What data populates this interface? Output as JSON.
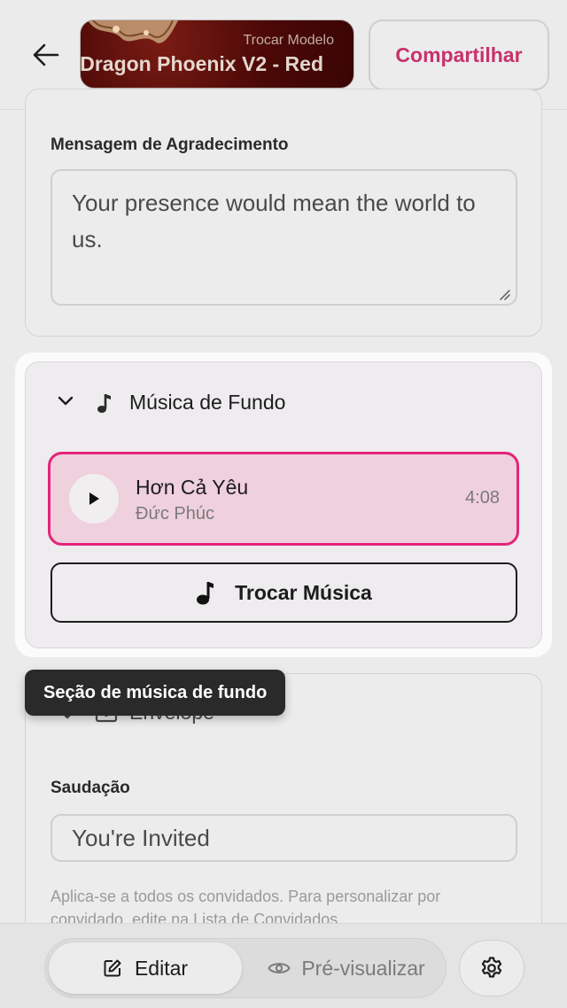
{
  "header": {
    "template_swap_label": "Trocar Modelo",
    "template_name": "Dragon Phoenix V2 - Red",
    "share_label": "Compartilhar"
  },
  "thanks_section": {
    "label": "Mensagem de Agradecimento",
    "value": "Your presence would mean the world to us."
  },
  "music_section": {
    "title": "Música de Fundo",
    "track": {
      "title": "Hơn Cả Yêu",
      "artist": "Đức Phúc",
      "duration": "4:08"
    },
    "swap_button_label": "Trocar Música"
  },
  "tooltip": {
    "text": "Seção de música de fundo"
  },
  "envelope_section": {
    "title": "Envelope",
    "greeting_label": "Saudação",
    "greeting_value": "You're Invited",
    "helper_text": "Aplica-se a todos os convidados. Para personalizar por convidado, edite na Lista de Convidados."
  },
  "bottom_bar": {
    "edit_label": "Editar",
    "preview_label": "Pré-visualizar"
  },
  "colors": {
    "accent": "#e3247a",
    "share_text": "#c8326a",
    "track_bg": "#efd0dd",
    "tooltip_bg": "#2a2a2a"
  },
  "icons": [
    "back-arrow-icon",
    "chevron-down-icon",
    "music-note-icon",
    "play-icon",
    "envelope-icon",
    "edit-icon",
    "eye-icon",
    "gear-icon"
  ]
}
